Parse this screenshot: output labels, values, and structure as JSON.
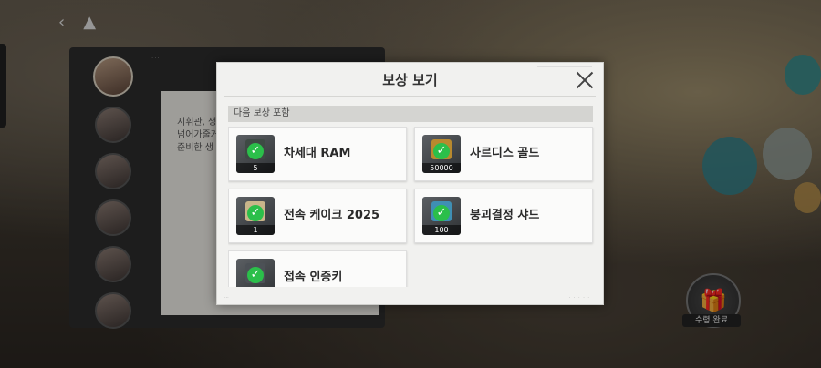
{
  "modal": {
    "title": "보상 보기",
    "section_label": "다음 보상 포함",
    "rewards": [
      {
        "name": "차세대 RAM",
        "quantity": "5",
        "icon": "ram-chip-icon",
        "art_color": "#3e4a44"
      },
      {
        "name": "사르디스 골드",
        "quantity": "50000",
        "icon": "gold-bar-icon",
        "art_color": "#b8892e"
      },
      {
        "name": "전속 케이크 2025",
        "quantity": "1",
        "icon": "cake-icon",
        "art_color": "#c9b58a"
      },
      {
        "name": "붕괴결정 샤드",
        "quantity": "100",
        "icon": "crystal-shard-icon",
        "art_color": "#3f8fb4"
      },
      {
        "name": "접속 인증키",
        "quantity": "",
        "icon": "access-key-icon",
        "art_color": "#4c5156"
      }
    ]
  },
  "messenger": {
    "chat_lines": [
      "지휘관, 생",
      "넘어가줄거",
      "준비한 생"
    ]
  },
  "claim": {
    "label": "수령 완료"
  },
  "colors": {
    "check": "#2bbf4a",
    "modal_bg": "#f1f1ef"
  }
}
